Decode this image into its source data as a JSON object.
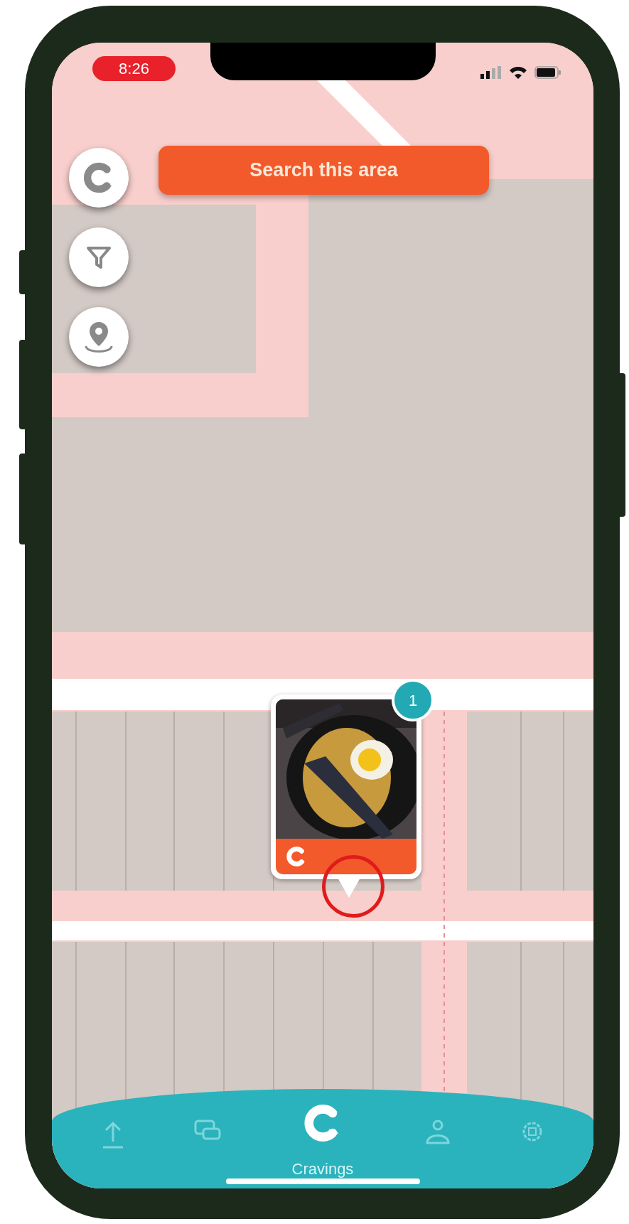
{
  "status_bar": {
    "time": "8:26"
  },
  "search_button": {
    "label": "Search this area"
  },
  "map_controls": [
    {
      "kind": "logo"
    },
    {
      "kind": "filter"
    },
    {
      "kind": "location"
    }
  ],
  "marker": {
    "badge": "1"
  },
  "bottom_nav": {
    "items": [
      {
        "kind": "upload",
        "selected": false
      },
      {
        "kind": "chat",
        "selected": false
      },
      {
        "kind": "cravings",
        "label": "Cravings",
        "selected": true
      },
      {
        "kind": "profile",
        "selected": false
      },
      {
        "kind": "settings",
        "selected": false
      }
    ]
  }
}
